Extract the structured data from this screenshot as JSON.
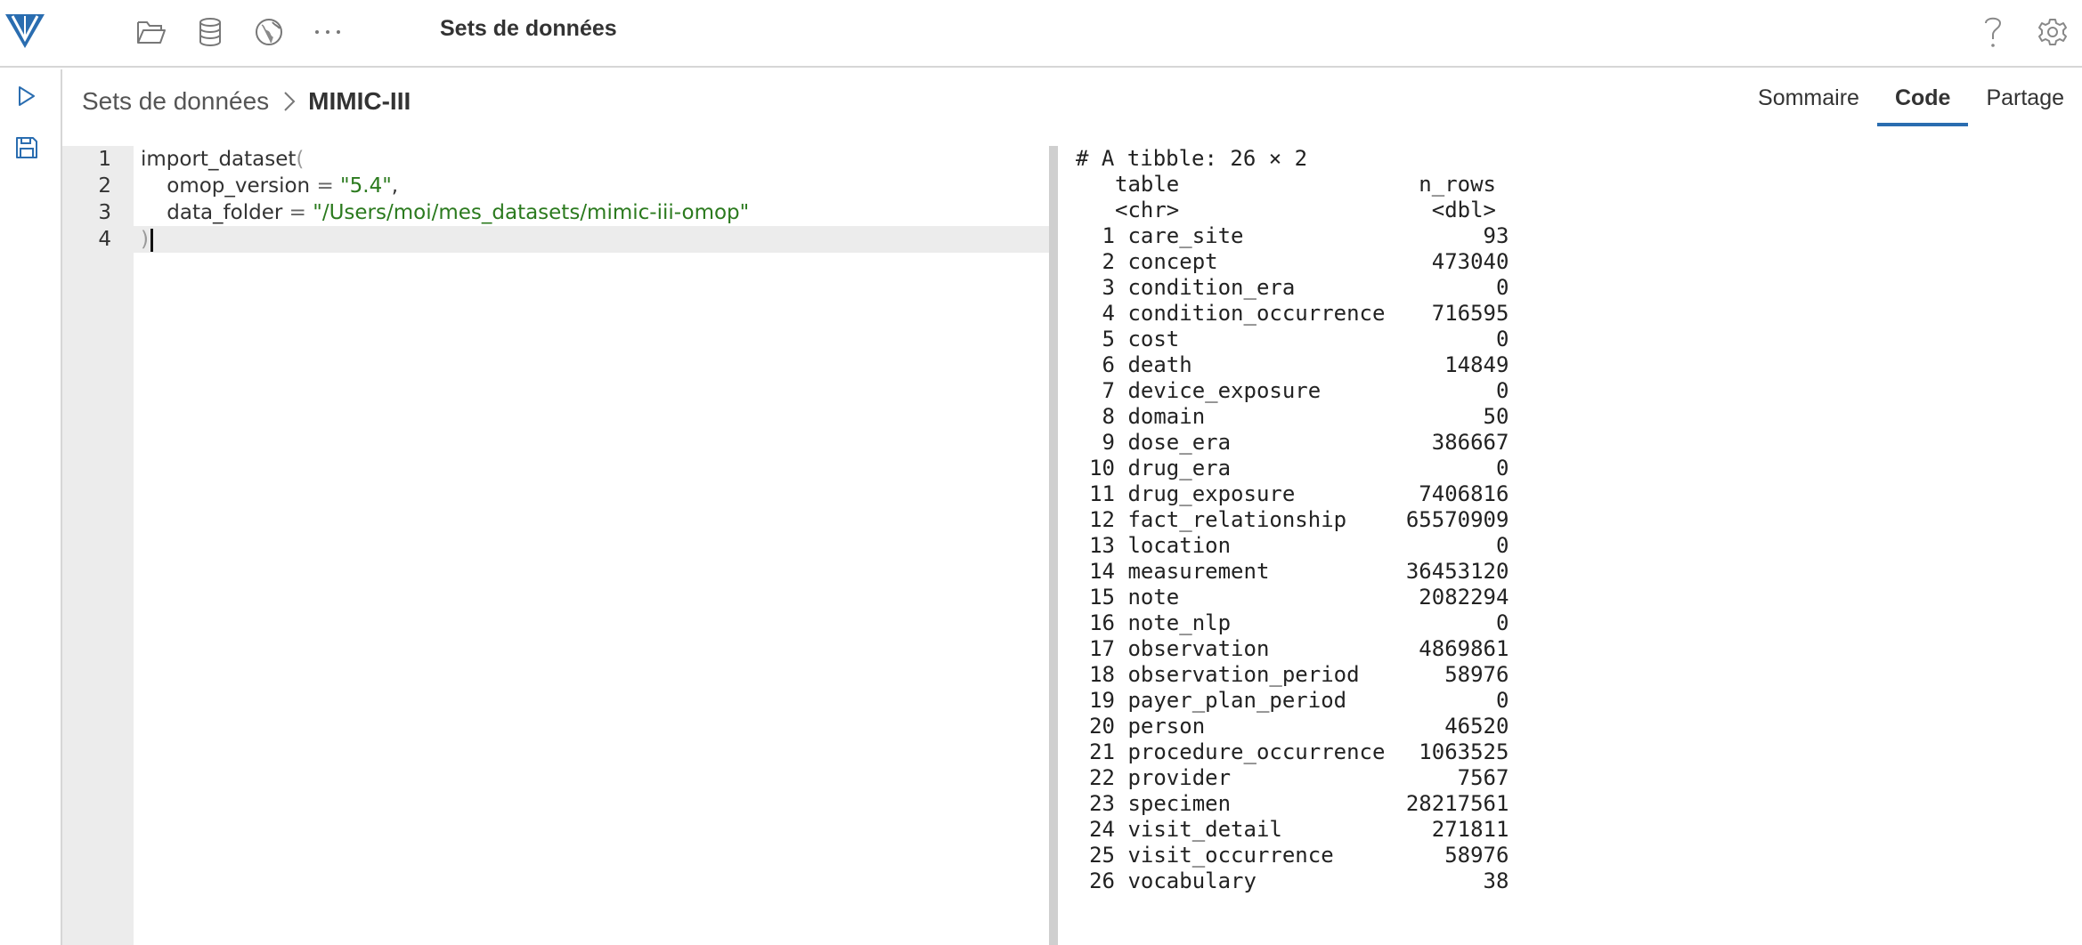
{
  "app": {
    "title": "Sets de données"
  },
  "breadcrumb": {
    "parent": "Sets de données",
    "current": "MIMIC-III"
  },
  "tabs": [
    {
      "label": "Sommaire",
      "active": false
    },
    {
      "label": "Code",
      "active": true
    },
    {
      "label": "Partage",
      "active": false
    }
  ],
  "colors": {
    "accent": "#2a6db0",
    "string": "#2b7a1e",
    "logo": "#2a6db0"
  },
  "editor": {
    "lines": [
      {
        "no": "1",
        "fn": "import_dataset",
        "open": "("
      },
      {
        "no": "2",
        "arg": "omop_version",
        "eq": "=",
        "val": "\"5.4\"",
        "tail": ","
      },
      {
        "no": "3",
        "arg": "data_folder",
        "eq": "=",
        "val": "\"/Users/moi/mes_datasets/mimic-iii-omop\""
      },
      {
        "no": "4",
        "close": ")"
      }
    ]
  },
  "console": {
    "header": "# A tibble: 26 × 2",
    "col_names": [
      "table",
      "n_rows"
    ],
    "col_types": [
      "<chr>",
      "<dbl>"
    ],
    "rows": [
      {
        "i": "1",
        "table": "care_site",
        "n": "93"
      },
      {
        "i": "2",
        "table": "concept",
        "n": "473040"
      },
      {
        "i": "3",
        "table": "condition_era",
        "n": "0"
      },
      {
        "i": "4",
        "table": "condition_occurrence",
        "n": "716595"
      },
      {
        "i": "5",
        "table": "cost",
        "n": "0"
      },
      {
        "i": "6",
        "table": "death",
        "n": "14849"
      },
      {
        "i": "7",
        "table": "device_exposure",
        "n": "0"
      },
      {
        "i": "8",
        "table": "domain",
        "n": "50"
      },
      {
        "i": "9",
        "table": "dose_era",
        "n": "386667"
      },
      {
        "i": "10",
        "table": "drug_era",
        "n": "0"
      },
      {
        "i": "11",
        "table": "drug_exposure",
        "n": "7406816"
      },
      {
        "i": "12",
        "table": "fact_relationship",
        "n": "65570909"
      },
      {
        "i": "13",
        "table": "location",
        "n": "0"
      },
      {
        "i": "14",
        "table": "measurement",
        "n": "36453120"
      },
      {
        "i": "15",
        "table": "note",
        "n": "2082294"
      },
      {
        "i": "16",
        "table": "note_nlp",
        "n": "0"
      },
      {
        "i": "17",
        "table": "observation",
        "n": "4869861"
      },
      {
        "i": "18",
        "table": "observation_period",
        "n": "58976"
      },
      {
        "i": "19",
        "table": "payer_plan_period",
        "n": "0"
      },
      {
        "i": "20",
        "table": "person",
        "n": "46520"
      },
      {
        "i": "21",
        "table": "procedure_occurrence",
        "n": "1063525"
      },
      {
        "i": "22",
        "table": "provider",
        "n": "7567"
      },
      {
        "i": "23",
        "table": "specimen",
        "n": "28217561"
      },
      {
        "i": "24",
        "table": "visit_detail",
        "n": "271811"
      },
      {
        "i": "25",
        "table": "visit_occurrence",
        "n": "58976"
      },
      {
        "i": "26",
        "table": "vocabulary",
        "n": "38"
      }
    ]
  }
}
